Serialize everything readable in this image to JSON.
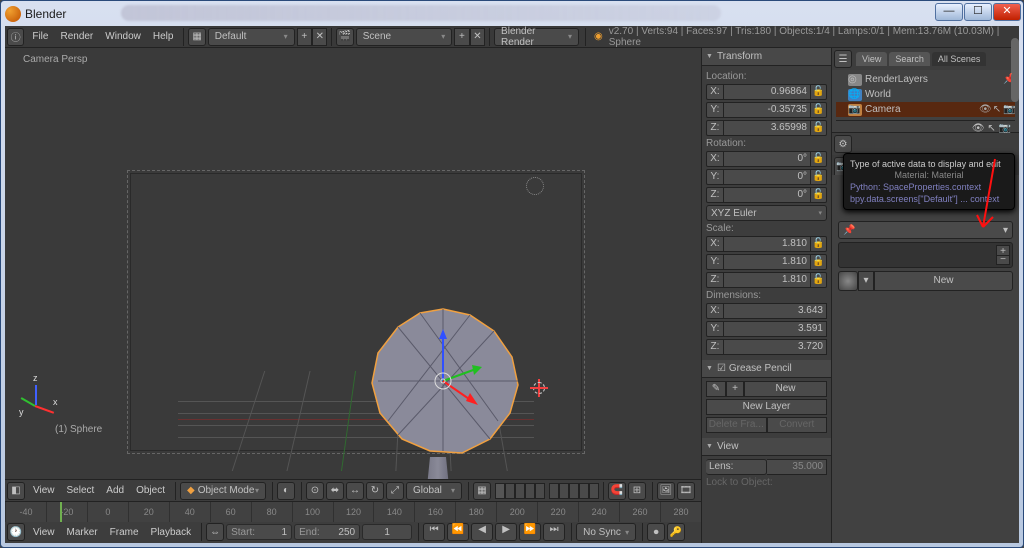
{
  "window": {
    "title": "Blender"
  },
  "info_header": {
    "menus": [
      "File",
      "Render",
      "Window",
      "Help"
    ],
    "screen_layout": "Default",
    "scene": "Scene",
    "render_engine": "Blender Render",
    "stats": "v2.70 | Verts:94 | Faces:97 | Tris:180 | Objects:1/4 | Lamps:0/1 | Mem:13.76M (10.03M) | Sphere"
  },
  "view3d": {
    "camera_label": "Camera Persp",
    "object_label": "(1) Sphere",
    "header_menus": [
      "View",
      "Select",
      "Add",
      "Object"
    ],
    "mode": "Object Mode",
    "orientation": "Global"
  },
  "n_panel": {
    "transform": {
      "title": "Transform",
      "location_label": "Location:",
      "rotation_label": "Rotation:",
      "scale_label": "Scale:",
      "dimensions_label": "Dimensions:",
      "rotation_mode": "XYZ Euler",
      "location": {
        "x": "0.96864",
        "y": "-0.35735",
        "z": "3.65998"
      },
      "rotation": {
        "x": "0°",
        "y": "0°",
        "z": "0°"
      },
      "scale": {
        "x": "1.810",
        "y": "1.810",
        "z": "1.810"
      },
      "dimensions": {
        "x": "3.643",
        "y": "3.591",
        "z": "3.720"
      }
    },
    "grease": {
      "title": "Grease Pencil",
      "new": "New",
      "new_layer": "New Layer",
      "delete": "Delete Fra...",
      "convert": "Convert"
    },
    "view": {
      "title": "View",
      "lens_label": "Lens:",
      "lens_value": "35.000",
      "lock_label": "Lock to Object:"
    }
  },
  "outliner": {
    "tabs": [
      "View",
      "Search",
      "All Scenes"
    ],
    "items": [
      {
        "name": "RenderLayers",
        "sel": false,
        "depth": 1
      },
      {
        "name": "World",
        "sel": false,
        "depth": 1
      },
      {
        "name": "Camera",
        "sel": true,
        "depth": 1
      }
    ]
  },
  "properties": {
    "tooltip": {
      "title": "Type of active data to display and edit",
      "sub": "Material: Material",
      "py1": "Python: SpaceProperties.context",
      "py2": "bpy.data.screens[\"Default\"] ... context"
    },
    "new_button": "New"
  },
  "timeline": {
    "menus": [
      "View",
      "Marker",
      "Frame",
      "Playback"
    ],
    "start_label": "Start:",
    "start_val": "1",
    "end_label": "End:",
    "end_val": "250",
    "cur_val": "1",
    "sync": "No Sync",
    "ticks": [
      "-40",
      "-20",
      "0",
      "20",
      "40",
      "60",
      "80",
      "100",
      "120",
      "140",
      "160",
      "180",
      "200",
      "220",
      "240",
      "260",
      "280"
    ]
  }
}
